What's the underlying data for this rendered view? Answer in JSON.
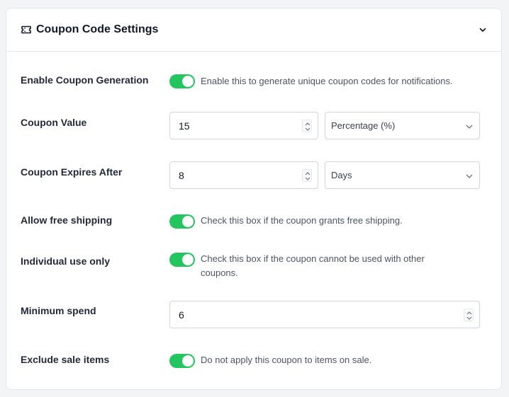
{
  "panel": {
    "title": "Coupon Code Settings",
    "header_icon": "ticket-icon",
    "collapse_icon": "chevron-down-icon"
  },
  "fields": {
    "enable_coupon": {
      "label": "Enable Coupon Generation",
      "enabled": true,
      "help": "Enable this to generate unique coupon codes for notifications."
    },
    "coupon_value": {
      "label": "Coupon Value",
      "value": "15",
      "type_selected": "Percentage (%)"
    },
    "coupon_expires": {
      "label": "Coupon Expires After",
      "value": "8",
      "unit_selected": "Days"
    },
    "free_shipping": {
      "label": "Allow free shipping",
      "enabled": true,
      "help": "Check this box if the coupon grants free shipping."
    },
    "individual_use": {
      "label": "Individual use only",
      "enabled": true,
      "help_line1": "Check this box if the coupon cannot be used with other",
      "help_line2": "coupons."
    },
    "minimum_spend": {
      "label": "Minimum spend",
      "value": "6"
    },
    "exclude_sale": {
      "label": "Exclude sale items",
      "enabled": true,
      "help": "Do not apply this coupon to items on sale."
    }
  },
  "colors": {
    "toggle_on": "#22c55e",
    "border": "#d1d5db",
    "background": "#f3f4f6"
  }
}
